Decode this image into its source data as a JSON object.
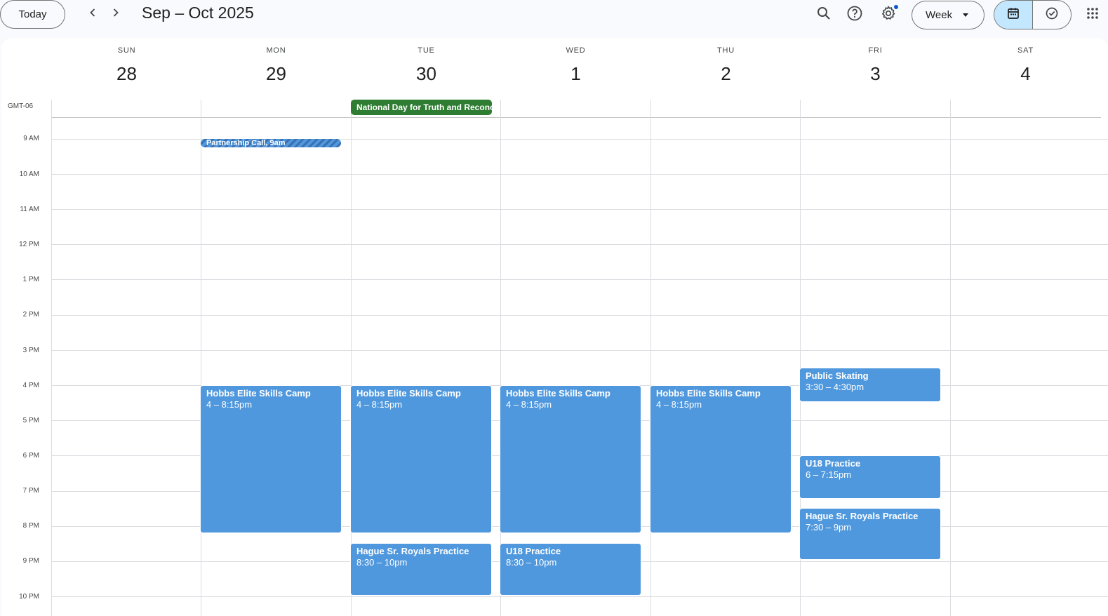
{
  "toolbar": {
    "today_label": "Today",
    "range_title": "Sep – Oct 2025",
    "view_label": "Week"
  },
  "icons": {
    "prev": "chevron-left-icon",
    "next": "chevron-right-icon",
    "search": "search-icon",
    "help": "help-icon",
    "settings": "gear-icon",
    "calendar_view": "calendar-icon",
    "tasks_view": "task-check-icon",
    "apps": "apps-grid-icon"
  },
  "colors": {
    "event_blue": "#5098dd",
    "holiday_green": "#2e7d32",
    "toggle_active": "#c2e7ff",
    "notification_dot": "#0b57d0"
  },
  "timezone": "GMT-06",
  "days": [
    {
      "name": "SUN",
      "num": "28"
    },
    {
      "name": "MON",
      "num": "29"
    },
    {
      "name": "TUE",
      "num": "30"
    },
    {
      "name": "WED",
      "num": "1"
    },
    {
      "name": "THU",
      "num": "2"
    },
    {
      "name": "FRI",
      "num": "3"
    },
    {
      "name": "SAT",
      "num": "4"
    }
  ],
  "hours": [
    "9 AM",
    "10 AM",
    "11 AM",
    "12 PM",
    "1 PM",
    "2 PM",
    "3 PM",
    "4 PM",
    "5 PM",
    "6 PM",
    "7 PM",
    "8 PM",
    "9 PM",
    "10 PM"
  ],
  "allday_events": [
    {
      "title": "National Day for Truth and Reconciliation",
      "day": "TUE"
    }
  ],
  "tentative_events": [
    {
      "title": "Partnership Call, 9am",
      "day": "MON"
    }
  ],
  "events": [
    {
      "title": "Hobbs Elite Skills Camp",
      "time": "4 – 8:15pm",
      "day": "MON"
    },
    {
      "title": "Hobbs Elite Skills Camp",
      "time": "4 – 8:15pm",
      "day": "TUE"
    },
    {
      "title": "Hague Sr. Royals Practice",
      "time": "8:30 – 10pm",
      "day": "TUE"
    },
    {
      "title": "Hobbs Elite Skills Camp",
      "time": "4 – 8:15pm",
      "day": "WED"
    },
    {
      "title": "U18 Practice",
      "time": "8:30 – 10pm",
      "day": "WED"
    },
    {
      "title": "Hobbs Elite Skills Camp",
      "time": "4 – 8:15pm",
      "day": "THU"
    },
    {
      "title": "Public Skating",
      "time": "3:30 – 4:30pm",
      "day": "FRI"
    },
    {
      "title": "U18 Practice",
      "time": "6 – 7:15pm",
      "day": "FRI"
    },
    {
      "title": "Hague Sr. Royals Practice",
      "time": "7:30 – 9pm",
      "day": "FRI"
    }
  ]
}
